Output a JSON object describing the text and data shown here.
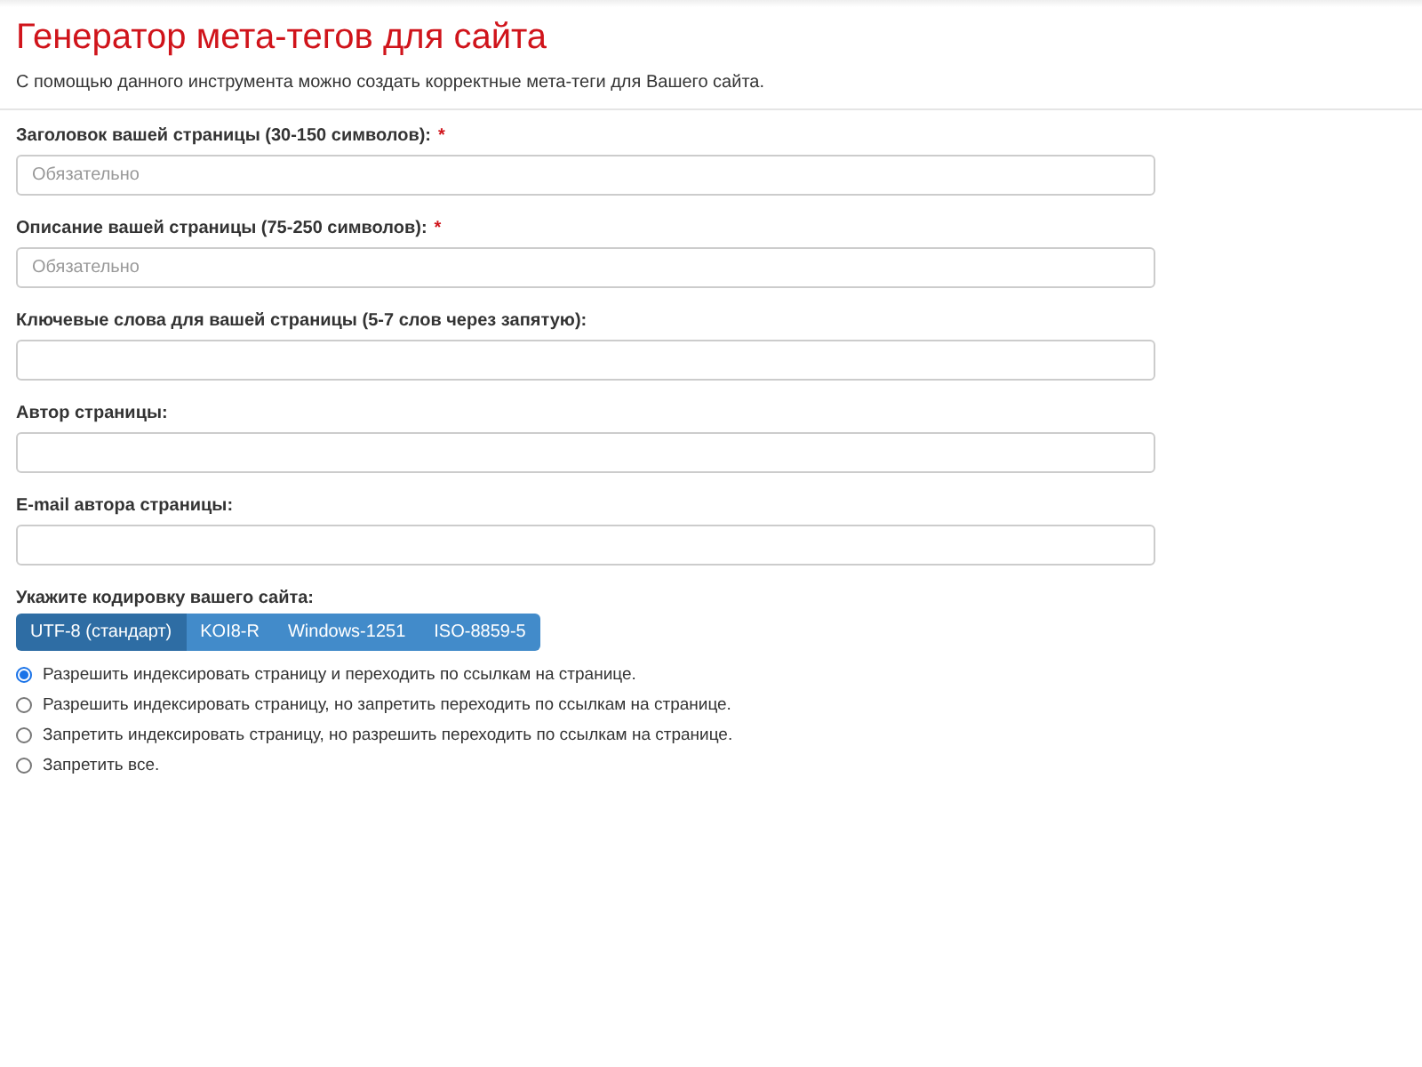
{
  "title": "Генератор мета-тегов для сайта",
  "subtitle": "С помощью данного инструмента можно создать корректные мета-теги для Вашего сайта.",
  "fields": [
    {
      "label": "Заголовок вашей страницы (30-150 символов):",
      "required_mark": "*",
      "placeholder": "Обязательно"
    },
    {
      "label": "Описание вашей страницы (75-250 символов):",
      "required_mark": "*",
      "placeholder": "Обязательно"
    },
    {
      "label": "Ключевые слова для вашей страницы (5-7 слов через запятую):"
    },
    {
      "label": "Автор страницы:"
    },
    {
      "label": "E-mail автора страницы:"
    }
  ],
  "encoding": {
    "label": "Укажите кодировку вашего сайта:",
    "options": [
      {
        "label": "UTF-8 (стандарт)",
        "selected": true
      },
      {
        "label": "KOI8-R",
        "selected": false
      },
      {
        "label": "Windows-1251",
        "selected": false
      },
      {
        "label": "ISO-8859-5",
        "selected": false
      }
    ]
  },
  "robots": [
    {
      "label": "Разрешить индексировать страницу и переходить по ссылкам на странице.",
      "selected": true
    },
    {
      "label": "Разрешить индексировать страницу, но запретить переходить по ссылкам на странице.",
      "selected": false
    },
    {
      "label": "Запретить индексировать страницу, но разрешить переходить по ссылкам на странице.",
      "selected": false
    },
    {
      "label": "Запретить все.",
      "selected": false
    }
  ]
}
